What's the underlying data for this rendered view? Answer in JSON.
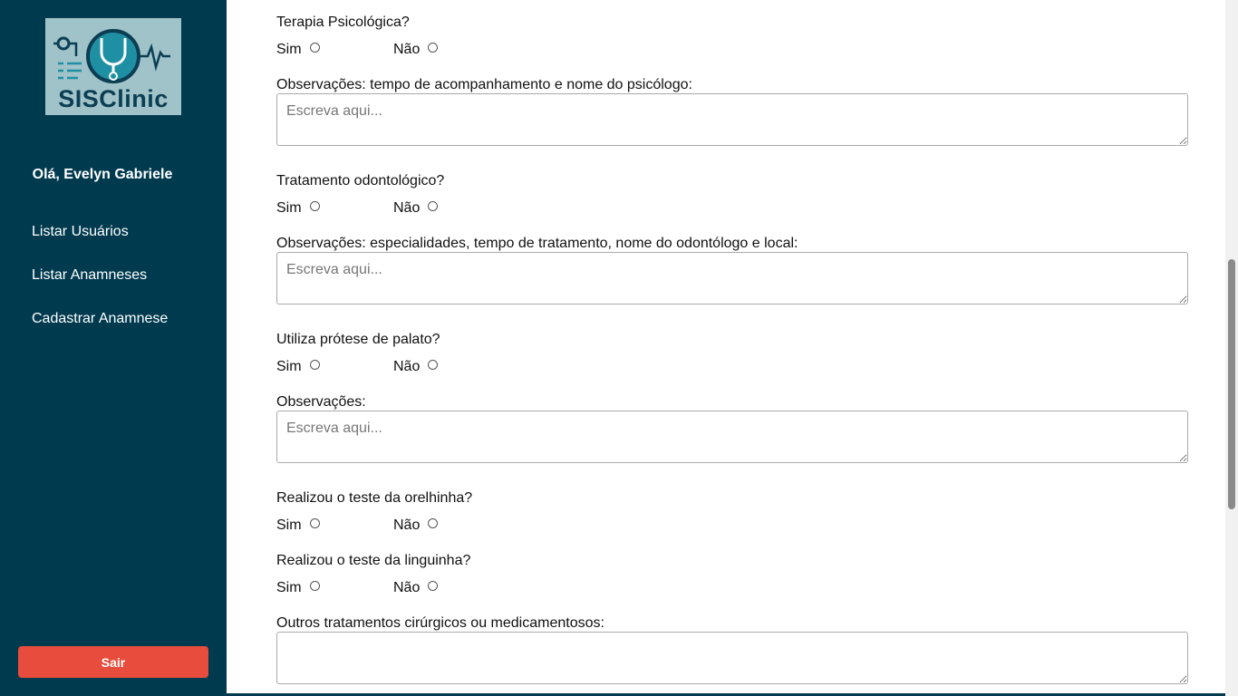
{
  "sidebar": {
    "logo_text": "SISClinic",
    "greeting": "Olá, Evelyn Gabriele",
    "nav": [
      {
        "label": "Listar Usuários"
      },
      {
        "label": "Listar Anamneses"
      },
      {
        "label": "Cadastrar Anamnese"
      }
    ],
    "logout_label": "Sair"
  },
  "form": {
    "q_psicologica": "Terapia Psicológica?",
    "obs_psicologica": "Observações: tempo de acompanhamento e nome do psicólogo:",
    "q_odonto": "Tratamento odontológico?",
    "obs_odonto": "Observações: especialidades, tempo de tratamento, nome do odontólogo e local:",
    "q_protese": "Utiliza prótese de palato?",
    "obs_protese": "Observações:",
    "q_orelhinha": "Realizou o teste da orelhinha?",
    "q_linguinha": "Realizou o teste da linguinha?",
    "outros": "Outros tratamentos cirúrgicos ou medicamentosos:",
    "opt_sim": "Sim",
    "opt_nao": "Não",
    "placeholder": "Escreva aqui..."
  },
  "colors": {
    "sidebar_bg": "#003a4f",
    "logout_bg": "#e74c3c"
  }
}
